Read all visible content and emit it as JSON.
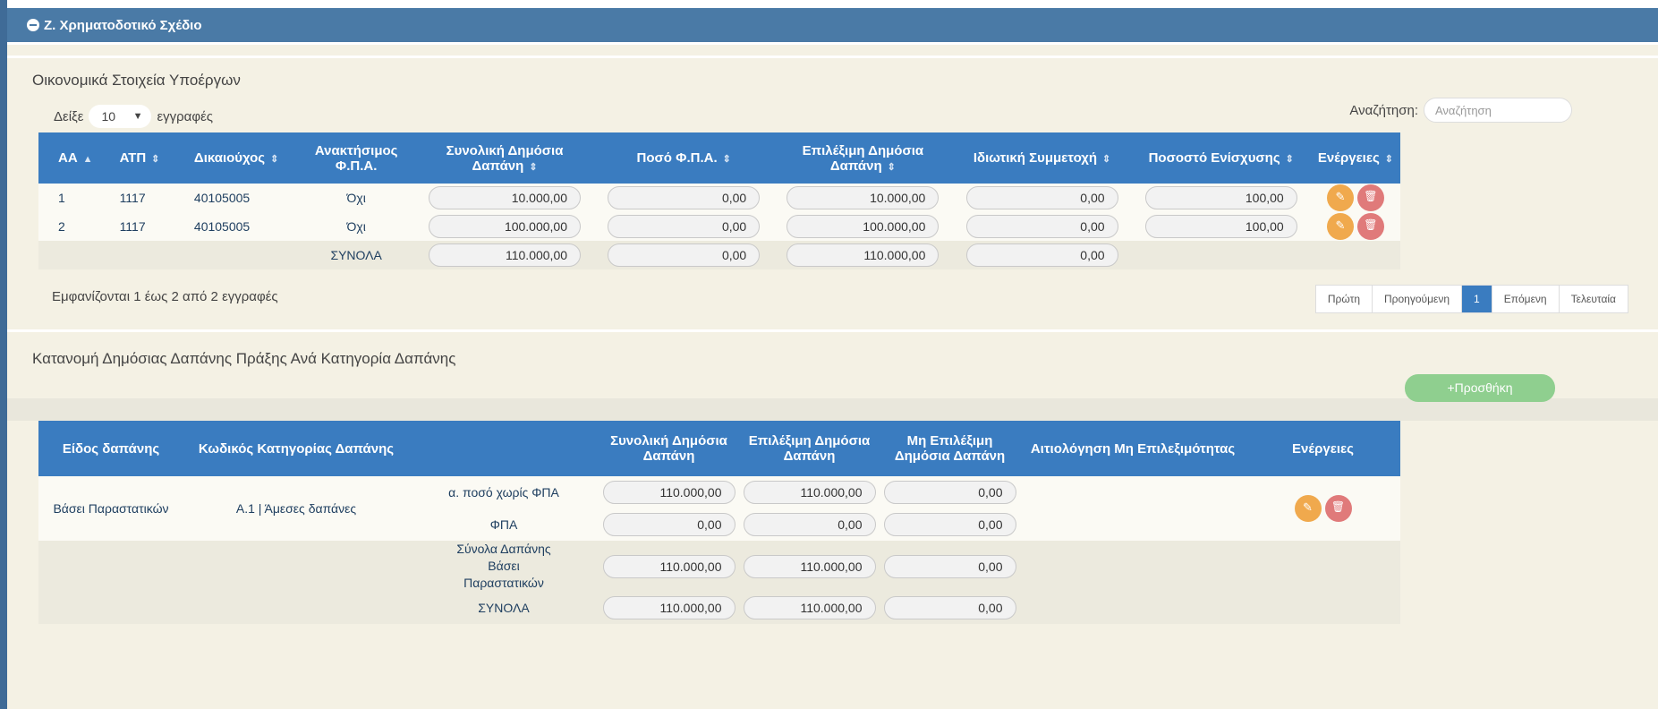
{
  "section": {
    "title": "Ζ. Χρηματοδοτικό Σχέδιο"
  },
  "subprojects": {
    "title": "Οικονομικά Στοιχεία Υποέργων",
    "show_prefix": "Δείξε",
    "show_value": "10",
    "show_suffix": "εγγραφές",
    "search_label": "Αναζήτηση:",
    "search_placeholder": "Αναζήτηση",
    "columns": [
      "ΑΑ",
      "ΑΤΠ",
      "Δικαιούχος",
      "Ανακτήσιμος Φ.Π.Α.",
      "Συνολική Δημόσια Δαπάνη",
      "Ποσό Φ.Π.Α.",
      "Επιλέξιμη Δημόσια Δαπάνη",
      "Ιδιωτική Συμμετοχή",
      "Ποσοστό Ενίσχυσης",
      "Ενέργειες"
    ],
    "rows": [
      {
        "aa": "1",
        "atp": "1117",
        "beneficiary": "40105005",
        "vat_recoverable": "Όχι",
        "total_public": "10.000,00",
        "vat": "0,00",
        "eligible_public": "10.000,00",
        "private": "0,00",
        "rate": "100,00"
      },
      {
        "aa": "2",
        "atp": "1117",
        "beneficiary": "40105005",
        "vat_recoverable": "Όχι",
        "total_public": "100.000,00",
        "vat": "0,00",
        "eligible_public": "100.000,00",
        "private": "0,00",
        "rate": "100,00"
      }
    ],
    "totals": {
      "label": "ΣΥΝΟΛΑ",
      "total_public": "110.000,00",
      "vat": "0,00",
      "eligible_public": "110.000,00",
      "private": "0,00"
    },
    "info": "Εμφανίζονται 1 έως 2 από 2 εγγραφές",
    "pager": {
      "first": "Πρώτη",
      "prev": "Προηγούμενη",
      "current": "1",
      "next": "Επόμενη",
      "last": "Τελευταία"
    }
  },
  "allocation": {
    "title": "Κατανομή Δημόσιας Δαπάνης Πράξης Ανά Κατηγορία Δαπάνης",
    "add_label": "+Προσθήκη",
    "columns": [
      "Είδος δαπάνης",
      "Κωδικός Κατηγορίας Δαπάνης",
      "Συνολική Δημόσια Δαπάνη",
      "Επιλέξιμη Δημόσια Δαπάνη",
      "Μη Επιλέξιμη Δημόσια Δαπάνη",
      "Αιτιολόγηση Μη Επιλεξιμότητας",
      "Ενέργειες"
    ],
    "row": {
      "type": "Βάσει Παραστατικών",
      "code": "Α.1 | Άμεσες δαπάνες",
      "lines": [
        {
          "label": "α. ποσό χωρίς ΦΠΑ",
          "total": "110.000,00",
          "eligible": "110.000,00",
          "non_eligible": "0,00"
        },
        {
          "label": "ΦΠΑ",
          "total": "0,00",
          "eligible": "0,00",
          "non_eligible": "0,00"
        }
      ]
    },
    "subtotal": {
      "label": "Σύνολα Δαπάνης Βάσει Παραστατικών",
      "total": "110.000,00",
      "eligible": "110.000,00",
      "non_eligible": "0,00"
    },
    "grand_total": {
      "label": "ΣΥΝΟΛΑ",
      "total": "110.000,00",
      "eligible": "110.000,00",
      "non_eligible": "0,00"
    }
  },
  "colors": {
    "header_bar": "#4a7aa6",
    "table_header": "#3a7cc0",
    "panel_bg": "#f4f1e4",
    "edit": "#f0a94d",
    "delete": "#e07a7a",
    "add": "#8fcf8f"
  }
}
